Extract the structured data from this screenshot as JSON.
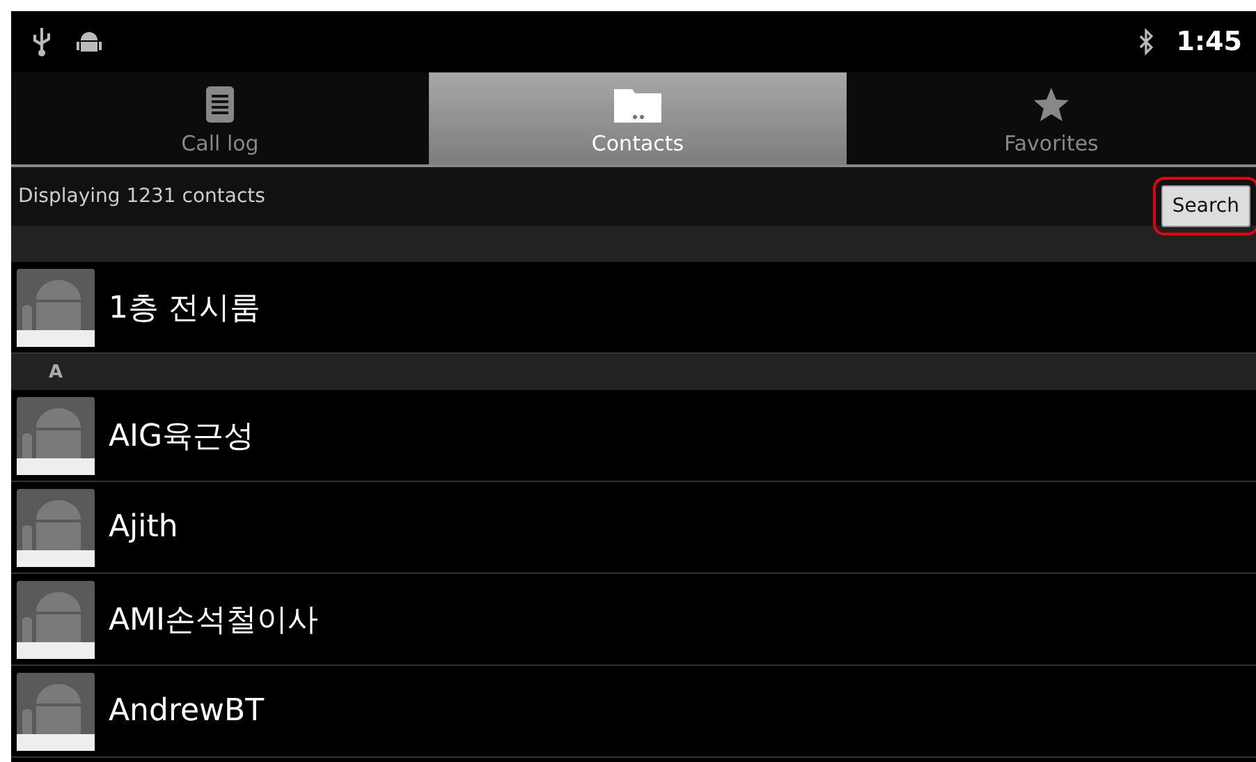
{
  "status_bar": {
    "time": "1:45"
  },
  "tabs": [
    {
      "label": "Call log",
      "kind": "list",
      "selected": false
    },
    {
      "label": "Contacts",
      "kind": "folder",
      "selected": true
    },
    {
      "label": "Favorites",
      "kind": "star",
      "selected": false
    }
  ],
  "info_bar": {
    "text": "Displaying 1231 contacts",
    "search_button": {
      "label": "Search",
      "highlighted": true
    }
  },
  "sections": [
    {
      "contacts": [
        {
          "name": "1층 전시룸"
        }
      ]
    },
    {
      "letter": "A",
      "contacts": [
        {
          "name": "AIG육근성"
        },
        {
          "name": "Ajith"
        },
        {
          "name": "AMI손석철이사"
        },
        {
          "name": "AndrewBT"
        }
      ]
    }
  ]
}
